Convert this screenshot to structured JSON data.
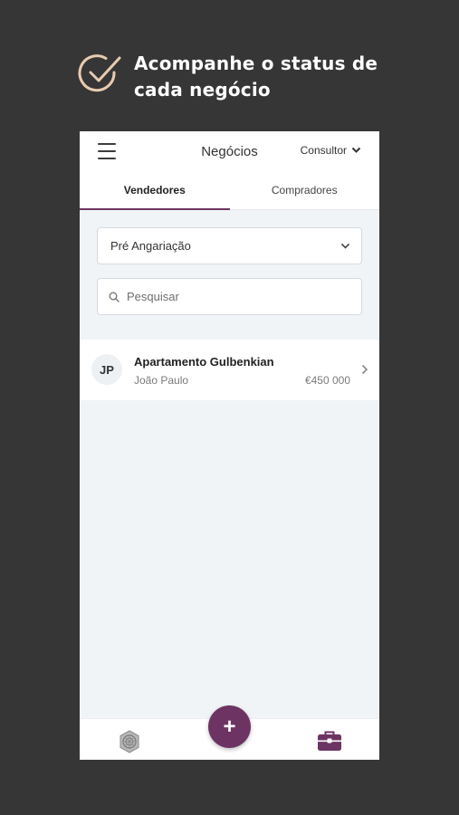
{
  "promo": {
    "text": "Acompanhe o status de cada negócio",
    "icon": "check-circle-icon"
  },
  "appbar": {
    "title": "Negócios",
    "role_label": "Consultor"
  },
  "tabs": [
    {
      "label": "Vendedores",
      "active": true
    },
    {
      "label": "Compradores",
      "active": false
    }
  ],
  "filter": {
    "selected": "Pré Angariação"
  },
  "search": {
    "placeholder": "Pesquisar",
    "value": ""
  },
  "deals": [
    {
      "initials": "JP",
      "title": "Apartamento Gulbenkian",
      "person": "João Paulo",
      "price": "€450 000"
    }
  ],
  "bottom_nav": {
    "home_icon": "company-logo-icon",
    "deals_icon": "briefcase-icon",
    "fab_label": "+"
  },
  "colors": {
    "accent": "#6d3463",
    "background": "#363636",
    "promo_icon": "#e8cbb0"
  }
}
